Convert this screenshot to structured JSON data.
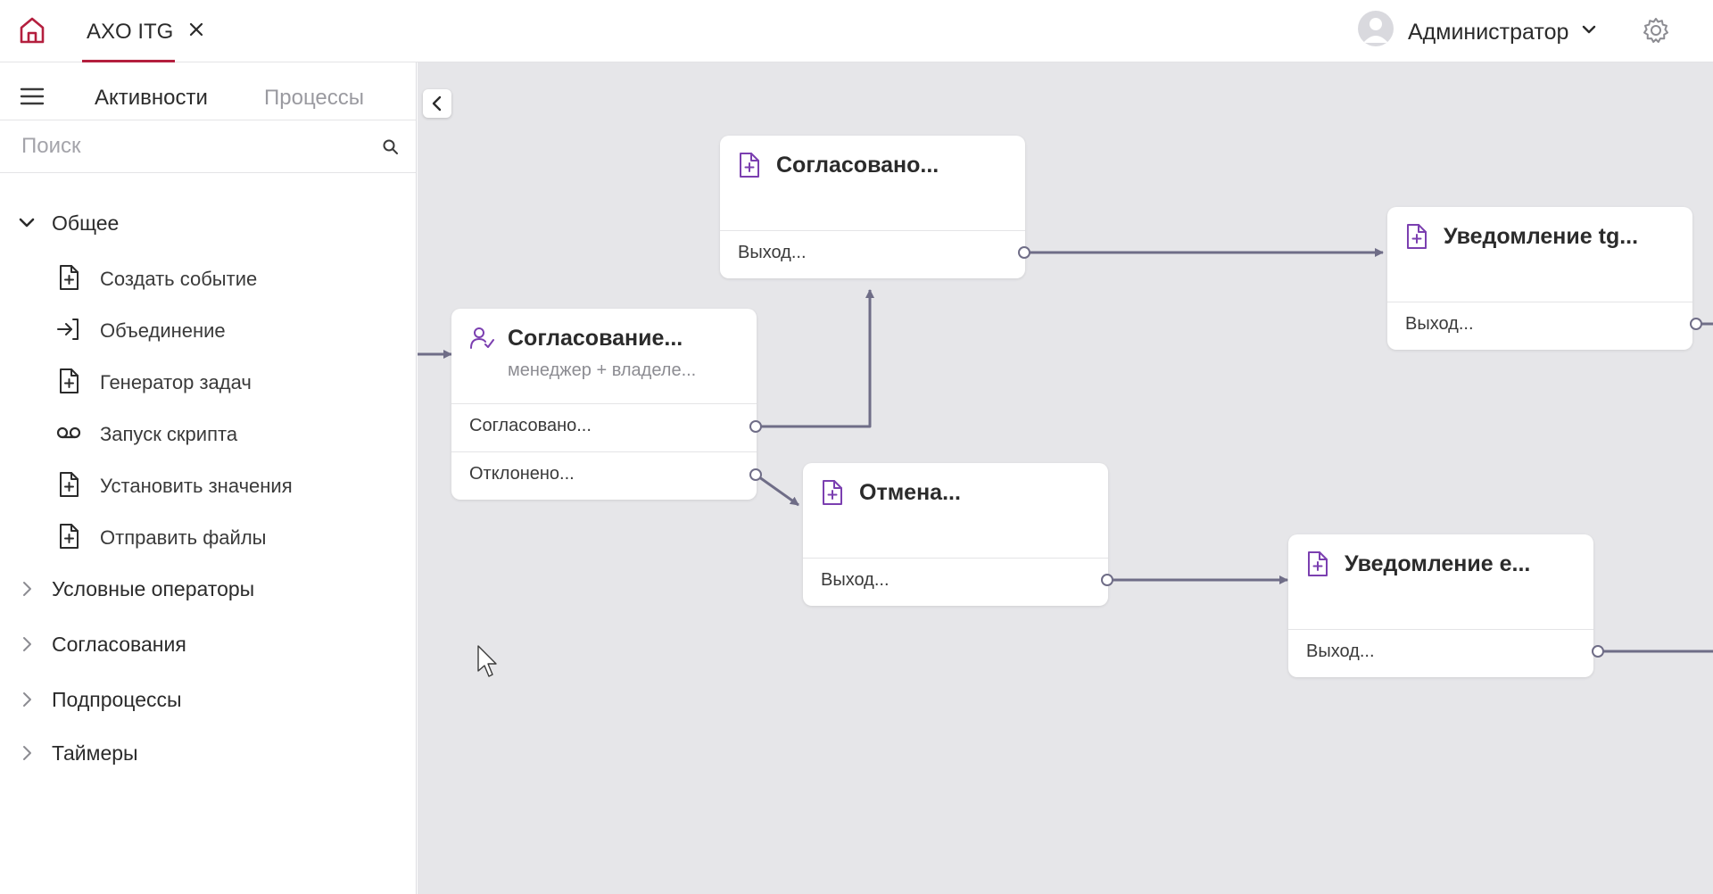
{
  "header": {
    "tab_title": "AXO ITG",
    "user_name": "Администратор",
    "icons": [
      "home-icon",
      "close-icon",
      "user-avatar-icon",
      "chevron-down-icon",
      "gear-icon"
    ],
    "accent_color": "#b41f3e"
  },
  "sidebar": {
    "tabs": [
      "Активности",
      "Процессы"
    ],
    "active_tab": "Активности",
    "search_placeholder": "Поиск",
    "groups": [
      {
        "label": "Общее",
        "expanded": true,
        "items": [
          {
            "label": "Создать событие",
            "icon": "file-plus-icon"
          },
          {
            "label": "Объединение",
            "icon": "merge-icon"
          },
          {
            "label": "Генератор задач",
            "icon": "file-plus-icon"
          },
          {
            "label": "Запуск скрипта",
            "icon": "script-icon"
          },
          {
            "label": "Установить значения",
            "icon": "file-plus-icon"
          },
          {
            "label": "Отправить файлы",
            "icon": "file-plus-icon"
          }
        ]
      },
      {
        "label": "Условные операторы",
        "expanded": false
      },
      {
        "label": "Согласования",
        "expanded": false
      },
      {
        "label": "Подпроцессы",
        "expanded": false
      },
      {
        "label": "Таймеры",
        "expanded": false
      }
    ]
  },
  "canvas": {
    "edge_color": "#6f6d87",
    "icon_color": "#7b3fb0",
    "nodes": [
      {
        "id": "approval",
        "title": "Согласование...",
        "subtitle": "менеджер + владеле...",
        "icon": "user-check-icon",
        "outputs": [
          "Согласовано...",
          "Отклонено..."
        ]
      },
      {
        "id": "approved",
        "title": "Согласовано...",
        "icon": "file-plus-icon",
        "outputs": [
          "Выход..."
        ]
      },
      {
        "id": "notify-tg",
        "title": "Уведомление tg...",
        "icon": "file-plus-icon",
        "outputs": [
          "Выход..."
        ]
      },
      {
        "id": "cancel",
        "title": "Отмена...",
        "icon": "file-plus-icon",
        "outputs": [
          "Выход..."
        ]
      },
      {
        "id": "notify-email",
        "title": "Уведомление е...",
        "icon": "file-plus-icon",
        "outputs": [
          "Выход..."
        ]
      }
    ]
  }
}
